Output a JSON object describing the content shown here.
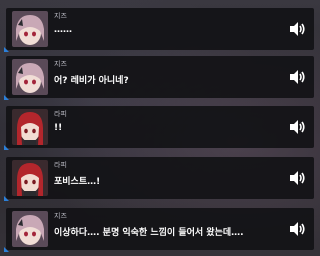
{
  "dialogue_log": [
    {
      "speaker": "지즈",
      "text": "……",
      "character": "jiz",
      "voice_icon": "speaker-volume-icon"
    },
    {
      "speaker": "지즈",
      "text": "어? 레비가 아니네?",
      "character": "jiz",
      "voice_icon": "speaker-volume-icon"
    },
    {
      "speaker": "라피",
      "text": "!!",
      "character": "rapi",
      "voice_icon": "speaker-volume-icon"
    },
    {
      "speaker": "라피",
      "text": "포비스트…!",
      "character": "rapi",
      "voice_icon": "speaker-volume-icon"
    },
    {
      "speaker": "지즈",
      "text": "이상하다…. 분명 익숙한 느낌이 들어서 왔는데….",
      "character": "jiz",
      "voice_icon": "speaker-volume-icon"
    }
  ],
  "colors": {
    "accent": "#2b7fd8",
    "panel": "#121216",
    "jiz_hair": "#c9a8b6",
    "rapi_hair": "#b3262c"
  }
}
